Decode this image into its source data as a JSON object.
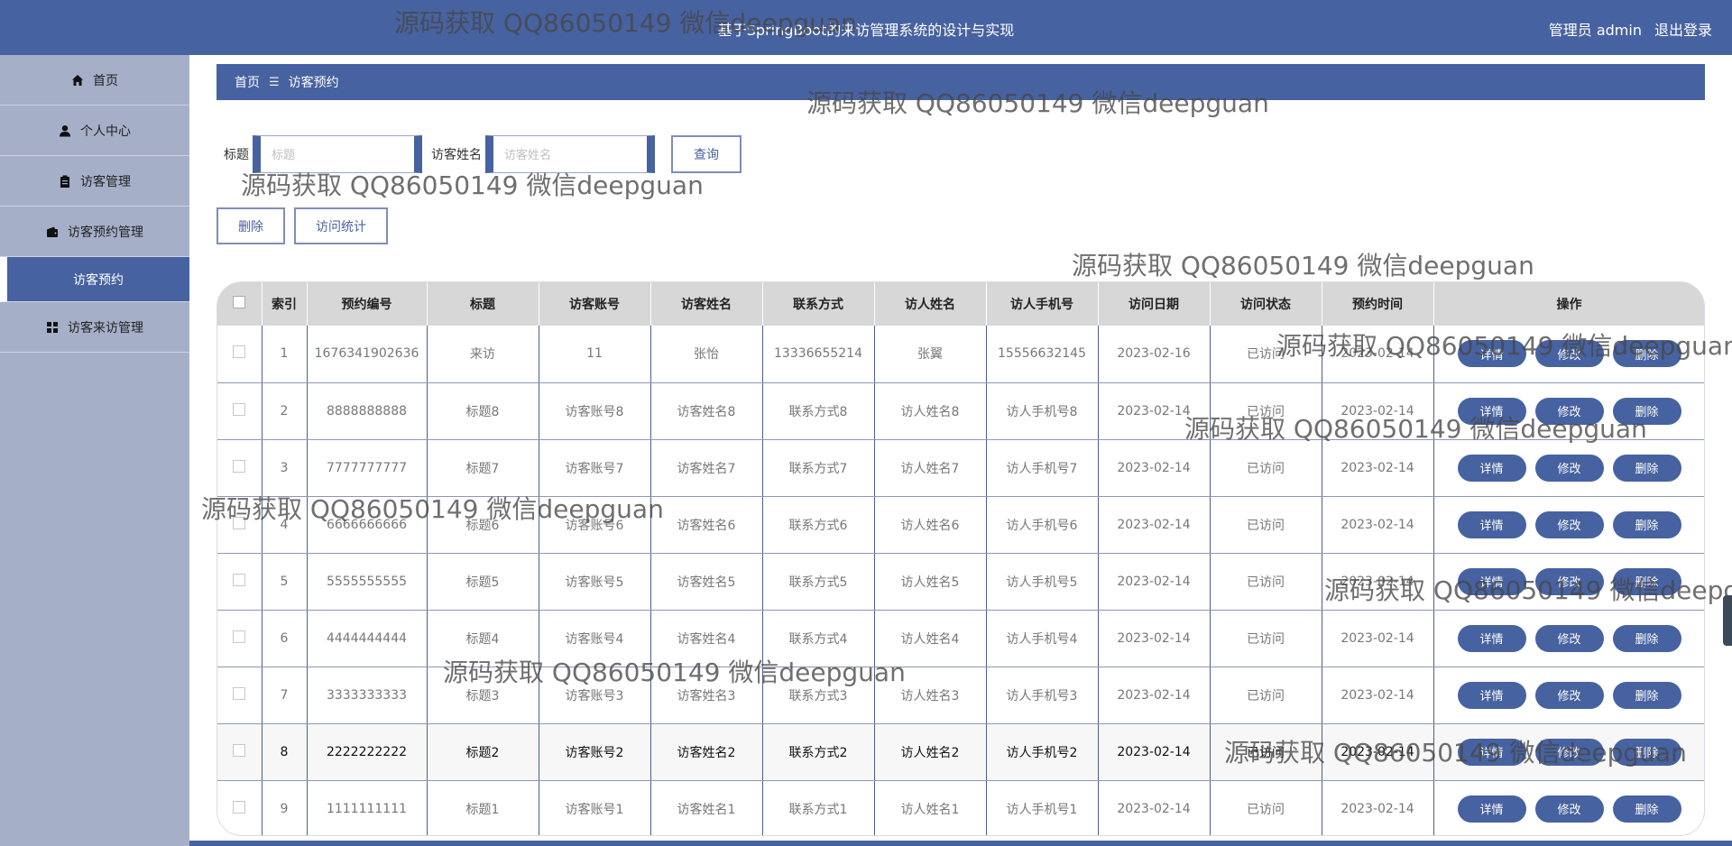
{
  "header": {
    "title": "基于SpringBoot的来访管理系统的设计与实现",
    "user_label": "管理员 admin",
    "logout_label": "退出登录"
  },
  "sidebar": {
    "items": [
      {
        "label": "首页",
        "icon": "home-icon"
      },
      {
        "label": "个人中心",
        "icon": "user-icon"
      },
      {
        "label": "访客管理",
        "icon": "clipboard-icon"
      },
      {
        "label": "访客预约管理",
        "icon": "wallet-icon"
      },
      {
        "label": "访客预约",
        "icon": ""
      },
      {
        "label": "访客来访管理",
        "icon": "grid-icon"
      }
    ]
  },
  "breadcrumb": {
    "home": "首页",
    "separator": "☰",
    "current": "访客预约"
  },
  "search": {
    "title_label": "标题",
    "title_placeholder": "标题",
    "name_label": "访客姓名",
    "name_placeholder": "访客姓名",
    "query_label": "查询"
  },
  "actions": {
    "delete_label": "删除",
    "stats_label": "访问统计"
  },
  "table": {
    "columns": [
      "索引",
      "预约编号",
      "标题",
      "访客账号",
      "访客姓名",
      "联系方式",
      "访人姓名",
      "访人手机号",
      "访问日期",
      "访问状态",
      "预约时间",
      "操作"
    ],
    "buttons": {
      "detail": "详情",
      "edit": "修改",
      "delete": "删除"
    },
    "rows": [
      {
        "index": "1",
        "code": "1676341902636",
        "title": "来访",
        "account": "11",
        "name": "张怡",
        "contact": "13336655214",
        "host": "张翼",
        "host_phone": "15556632145",
        "date": "2023-02-16",
        "status": "已访问",
        "time": "2023-02-14"
      },
      {
        "index": "2",
        "code": "8888888888",
        "title": "标题8",
        "account": "访客账号8",
        "name": "访客姓名8",
        "contact": "联系方式8",
        "host": "访人姓名8",
        "host_phone": "访人手机号8",
        "date": "2023-02-14",
        "status": "已访问",
        "time": "2023-02-14"
      },
      {
        "index": "3",
        "code": "7777777777",
        "title": "标题7",
        "account": "访客账号7",
        "name": "访客姓名7",
        "contact": "联系方式7",
        "host": "访人姓名7",
        "host_phone": "访人手机号7",
        "date": "2023-02-14",
        "status": "已访问",
        "time": "2023-02-14"
      },
      {
        "index": "4",
        "code": "6666666666",
        "title": "标题6",
        "account": "访客账号6",
        "name": "访客姓名6",
        "contact": "联系方式6",
        "host": "访人姓名6",
        "host_phone": "访人手机号6",
        "date": "2023-02-14",
        "status": "已访问",
        "time": "2023-02-14"
      },
      {
        "index": "5",
        "code": "5555555555",
        "title": "标题5",
        "account": "访客账号5",
        "name": "访客姓名5",
        "contact": "联系方式5",
        "host": "访人姓名5",
        "host_phone": "访人手机号5",
        "date": "2023-02-14",
        "status": "已访问",
        "time": "2023-02-14"
      },
      {
        "index": "6",
        "code": "4444444444",
        "title": "标题4",
        "account": "访客账号4",
        "name": "访客姓名4",
        "contact": "联系方式4",
        "host": "访人姓名4",
        "host_phone": "访人手机号4",
        "date": "2023-02-14",
        "status": "已访问",
        "time": "2023-02-14"
      },
      {
        "index": "7",
        "code": "3333333333",
        "title": "标题3",
        "account": "访客账号3",
        "name": "访客姓名3",
        "contact": "联系方式3",
        "host": "访人姓名3",
        "host_phone": "访人手机号3",
        "date": "2023-02-14",
        "status": "已访问",
        "time": "2023-02-14"
      },
      {
        "index": "8",
        "code": "2222222222",
        "title": "标题2",
        "account": "访客账号2",
        "name": "访客姓名2",
        "contact": "联系方式2",
        "host": "访人姓名2",
        "host_phone": "访人手机号2",
        "date": "2023-02-14",
        "status": "已访问",
        "time": "2023-02-14"
      },
      {
        "index": "9",
        "code": "1111111111",
        "title": "标题1",
        "account": "访客账号1",
        "name": "访客姓名1",
        "contact": "联系方式1",
        "host": "访人姓名1",
        "host_phone": "访人手机号1",
        "date": "2023-02-14",
        "status": "已访问",
        "time": "2023-02-14"
      }
    ]
  },
  "watermark": "源码获取 QQ86050149 微信deepguan",
  "colors": {
    "primary": "#4762a0",
    "sidebar": "#a6afc8",
    "header_cell": "#d7d7d7"
  }
}
